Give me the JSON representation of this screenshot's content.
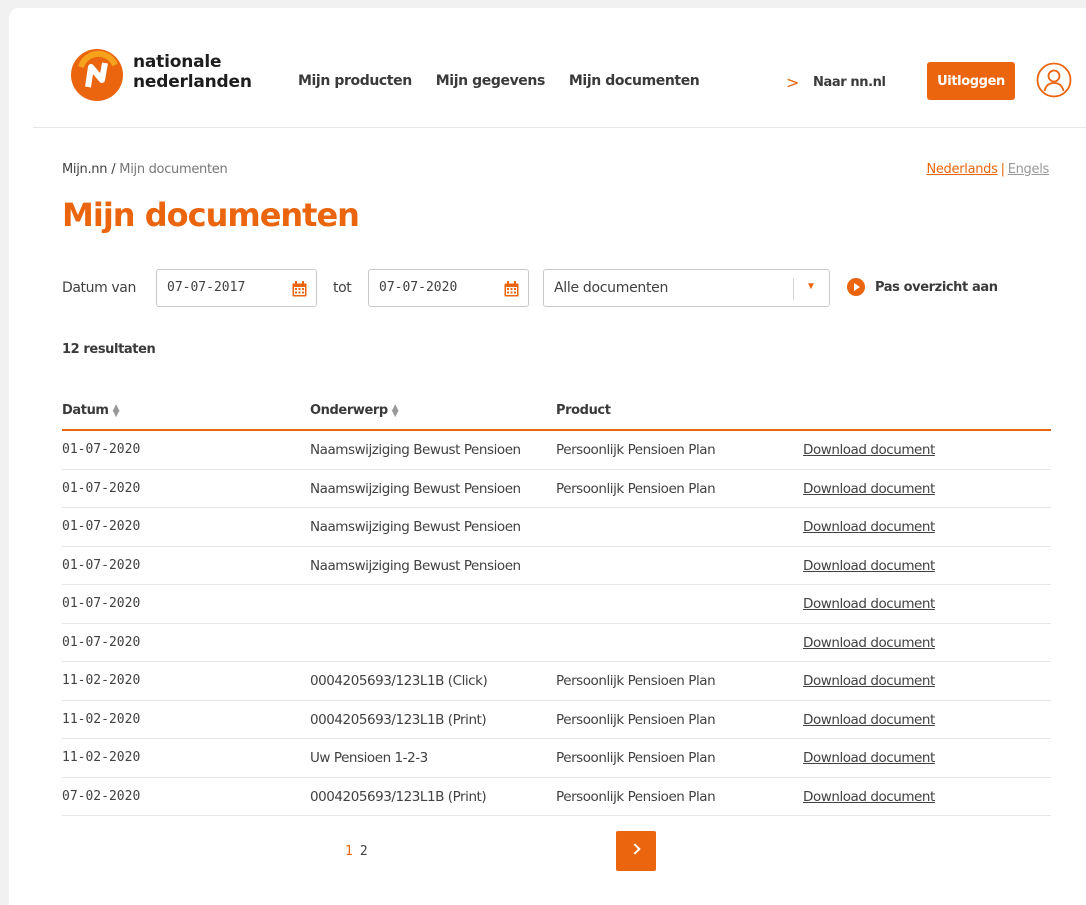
{
  "brand": {
    "line1": "nationale",
    "line2": "nederlanden"
  },
  "nav": {
    "items": [
      "Mijn producten",
      "Mijn gegevens",
      "Mijn documenten"
    ],
    "external_link": "Naar nn.nl",
    "logout": "Uitloggen"
  },
  "breadcrumb": {
    "home": "Mijn.nn",
    "separator": "/",
    "current": "Mijn documenten"
  },
  "language": {
    "active": "Nederlands",
    "separator": "|",
    "other": "Engels"
  },
  "page_title": "Mijn documenten",
  "filter": {
    "from_label": "Datum van",
    "from_value": "07-07-2017",
    "to_label": "tot",
    "to_value": "07-07-2020",
    "type_value": "Alle documenten",
    "apply_label": "Pas overzicht aan"
  },
  "results_count": "12 resultaten",
  "table": {
    "headers": {
      "date": "Datum",
      "subject": "Onderwerp",
      "product": "Product"
    },
    "rows": [
      {
        "date": "01-07-2020",
        "subject": "Naamswijziging Bewust Pensioen",
        "product": "Persoonlijk Pensioen Plan",
        "action": "Download document"
      },
      {
        "date": "01-07-2020",
        "subject": "Naamswijziging Bewust Pensioen",
        "product": "Persoonlijk Pensioen Plan",
        "action": "Download document"
      },
      {
        "date": "01-07-2020",
        "subject": "Naamswijziging Bewust Pensioen",
        "product": "",
        "action": "Download document"
      },
      {
        "date": "01-07-2020",
        "subject": "Naamswijziging Bewust Pensioen",
        "product": "",
        "action": "Download document"
      },
      {
        "date": "01-07-2020",
        "subject": "",
        "product": "",
        "action": "Download document"
      },
      {
        "date": "01-07-2020",
        "subject": "",
        "product": "",
        "action": "Download document"
      },
      {
        "date": "11-02-2020",
        "subject": "0004205693/123L1B (Click)",
        "product": "Persoonlijk Pensioen Plan",
        "action": "Download document"
      },
      {
        "date": "11-02-2020",
        "subject": "0004205693/123L1B (Print)",
        "product": "Persoonlijk Pensioen Plan",
        "action": "Download document"
      },
      {
        "date": "11-02-2020",
        "subject": "Uw Pensioen 1-2-3",
        "product": "Persoonlijk Pensioen Plan",
        "action": "Download document"
      },
      {
        "date": "07-02-2020",
        "subject": "0004205693/123L1B (Print)",
        "product": "Persoonlijk Pensioen Plan",
        "action": "Download document"
      }
    ]
  },
  "pagination": {
    "pages": [
      "1",
      "2"
    ],
    "current": "1"
  },
  "icons": {
    "logo": "nn-logo-icon",
    "user": "user-icon",
    "calendar": "calendar-icon",
    "next": "chevron-right-icon"
  },
  "colors": {
    "accent": "#ea650d",
    "text": "#414141"
  }
}
